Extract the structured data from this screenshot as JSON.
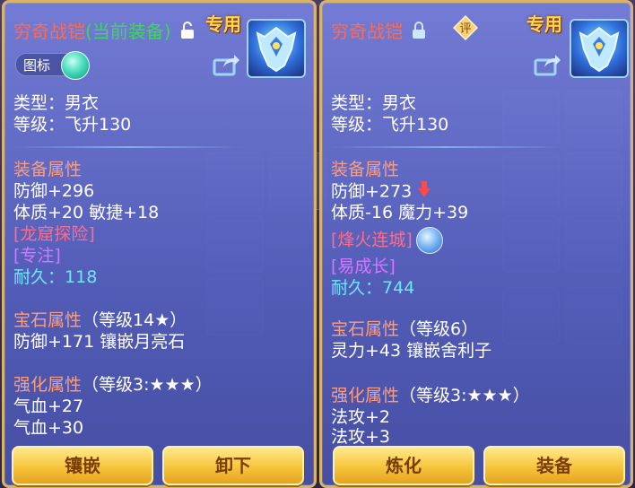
{
  "left": {
    "title": "穷奇战铠",
    "current_tag": "(当前装备)",
    "special": "专用",
    "toggle_label": "图标",
    "type_line": "类型：男衣",
    "level_line": "等级：飞升130",
    "equip_header": "装备属性",
    "attr1": "防御+296",
    "attr2": "体质+20 敏捷+18",
    "tag1": "[龙窟探险]",
    "tag2": "[专注]",
    "durability_label": "耐久：",
    "durability_value": "118",
    "gem_header": "宝石属性",
    "gem_level": "（等级14★）",
    "gem_line": "防御+171 镶嵌月亮石",
    "strengthen_header": "强化属性",
    "strengthen_level": "（等级3:★★★）",
    "s1": "气血+27",
    "s2": "气血+30",
    "btn_inlay": "镶嵌",
    "btn_unequip": "卸下"
  },
  "right": {
    "title": "穷奇战铠",
    "appraise": "评",
    "special": "专用",
    "type_line": "类型：男衣",
    "level_line": "等级：飞升130",
    "equip_header": "装备属性",
    "attr1": "防御+273",
    "attr2": "体质-16 魔力+39",
    "tag1": "[烽火连城]",
    "tag2": "[易成长]",
    "durability_label": "耐久：",
    "durability_value": "744",
    "gem_header": "宝石属性",
    "gem_level": "（等级6）",
    "gem_line": "灵力+43 镶嵌舍利子",
    "strengthen_header": "强化属性",
    "strengthen_level": "（等级3:★★★）",
    "s1": "法攻+2",
    "s2": "法攻+3",
    "btn_refine": "炼化",
    "btn_equip": "装备"
  },
  "colors": {
    "title": "#ff6a52",
    "current_tag": "#3bd95a",
    "section": "#ff9c7a",
    "durability": "#6fe6ff",
    "special": "#ffd64a",
    "button": "#f7c53c"
  },
  "icons": [
    "lock-open-icon",
    "lock-closed-icon",
    "share-icon",
    "appraise-badge-icon",
    "armor-item-icon",
    "down-arrow-icon",
    "refresh-orb-icon"
  ]
}
